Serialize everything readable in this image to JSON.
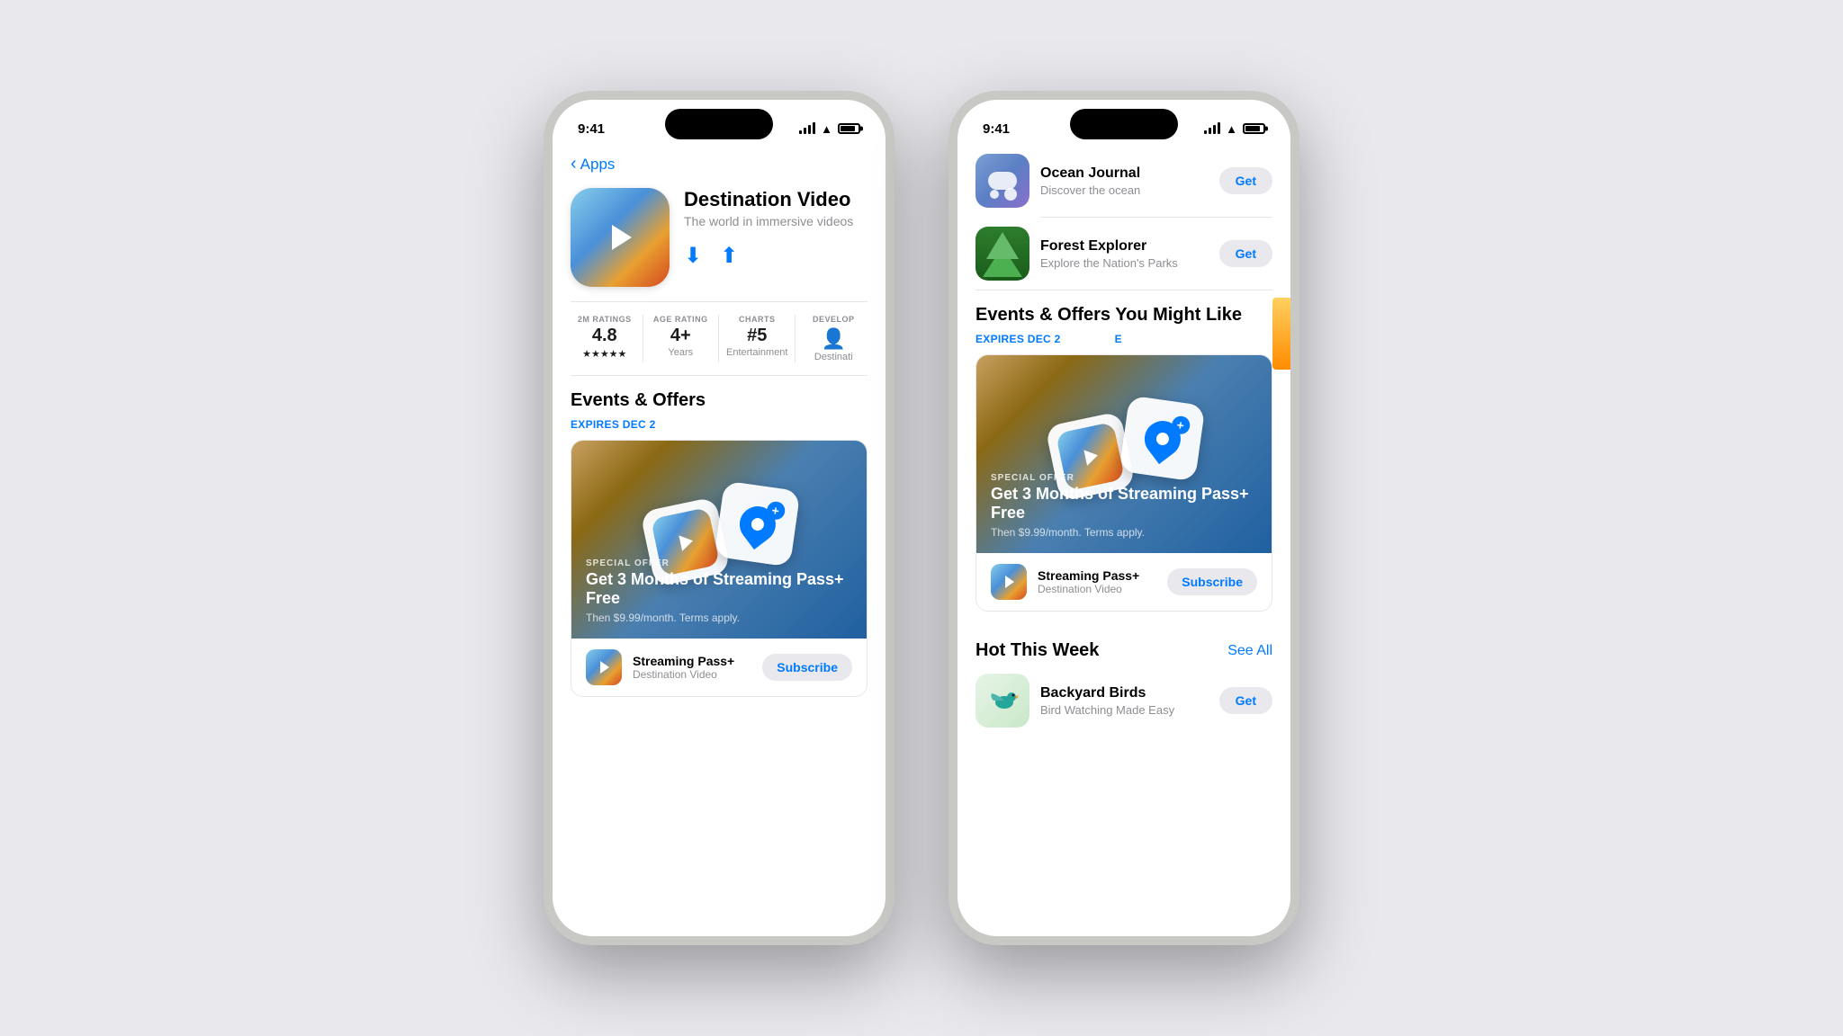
{
  "background_color": "#e8e8ed",
  "phone1": {
    "status": {
      "time": "9:41",
      "signal": true,
      "wifi": true,
      "battery": true
    },
    "back_button": "Apps",
    "app": {
      "name": "Destination Video",
      "subtitle": "The world in immersive videos",
      "ratings": {
        "count": "2M RATINGS",
        "score": "4.8",
        "stars": "★★★★★",
        "age_label": "AGE RATING",
        "age": "4+",
        "age_sub": "Years",
        "charts_label": "CHARTS",
        "charts": "#5",
        "charts_sub": "Entertainment",
        "dev_label": "DEVELOP",
        "dev": "Destinati"
      }
    },
    "events": {
      "section_title": "Events & Offers",
      "expires_label": "EXPIRES DEC 2",
      "special_offer_label": "SPECIAL OFFER",
      "offer_title": "Get 3 Months of Streaming Pass+ Free",
      "offer_sub": "Then $9.99/month. Terms apply.",
      "streaming_app_name": "Streaming Pass+",
      "streaming_app_sub": "Destination Video",
      "subscribe_button": "Subscribe"
    }
  },
  "phone2": {
    "status": {
      "time": "9:41"
    },
    "apps_list": [
      {
        "name": "Ocean Journal",
        "subtitle": "Discover the ocean",
        "icon_type": "ocean",
        "get_button": "Get"
      },
      {
        "name": "Forest Explorer",
        "subtitle": "Explore the Nation's Parks",
        "icon_type": "forest",
        "get_button": "Get"
      }
    ],
    "events": {
      "section_title": "Events & Offers You Might Like",
      "expires_label": "EXPIRES DEC 2",
      "expires_label2": "E",
      "special_offer_label": "SPECIAL OFFER",
      "offer_title": "Get 3 Months of Streaming Pass+ Free",
      "offer_sub": "Then $9.99/month. Terms apply.",
      "streaming_app_name": "Streaming Pass+",
      "streaming_app_sub": "Destination Video",
      "subscribe_button": "Subscribe"
    },
    "hot_week": {
      "section_title": "Hot This Week",
      "see_all": "See All",
      "apps": [
        {
          "name": "Backyard Birds",
          "subtitle": "Bird Watching Made Easy",
          "icon_type": "birds",
          "get_button": "Get"
        }
      ]
    }
  }
}
